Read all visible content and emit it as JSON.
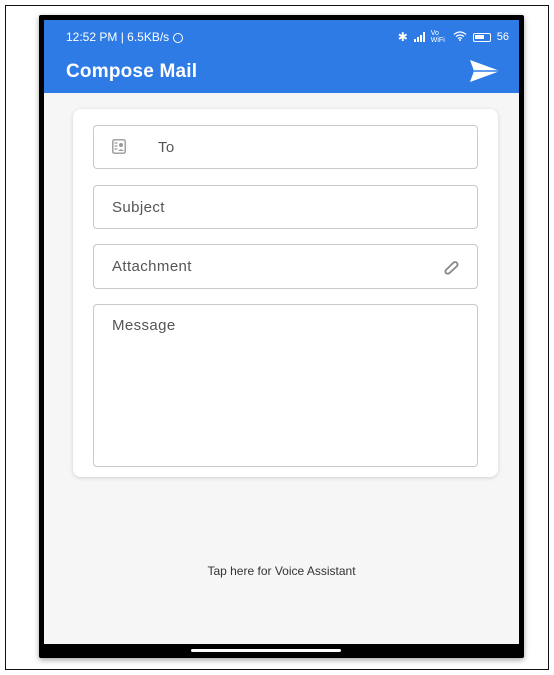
{
  "status_bar": {
    "time": "12:52 PM | 6.5KB/s",
    "network_label": "Vo WiFi",
    "battery": "56"
  },
  "app_bar": {
    "title": "Compose Mail",
    "send_icon": "send-icon"
  },
  "form": {
    "to_label": "To",
    "subject_label": "Subject",
    "attachment_label": "Attachment",
    "message_label": "Message"
  },
  "voice_assistant": "Tap here for Voice Assistant",
  "colors": {
    "accent": "#2f7be6",
    "background": "#f6f6f7",
    "field_border": "#c9c9cc"
  }
}
